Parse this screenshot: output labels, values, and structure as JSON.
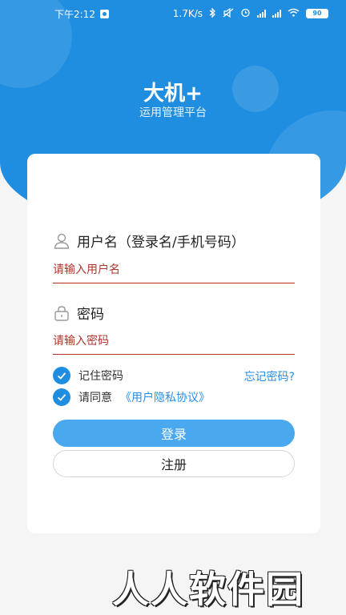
{
  "status_bar": {
    "time": "下午2:12",
    "network_speed": "1.7K/s",
    "battery": "90"
  },
  "header": {
    "title": "大机+",
    "subtitle": "运用管理平台"
  },
  "login_form": {
    "username_label": "用户名（登录名/手机号码）",
    "username_placeholder": "请输入用户名",
    "password_label": "密码",
    "password_placeholder": "请输入密码",
    "remember_password": "记住密码",
    "forgot_password": "忘记密码?",
    "agree_prefix": "请同意",
    "agreement_link": "《用户隐私协议》",
    "login_button": "登录",
    "register_button": "注册",
    "remember_checked": true,
    "agree_checked": true
  },
  "watermark": "人人软件园",
  "colors": {
    "primary_blue": "#1f8ee0",
    "button_blue": "#4aa8ee",
    "input_underline": "#b7312c",
    "link": "#2a8ee6"
  },
  "icons": {
    "user_field": "user-icon",
    "password_field": "lock-icon",
    "checkbox": "check-icon"
  }
}
